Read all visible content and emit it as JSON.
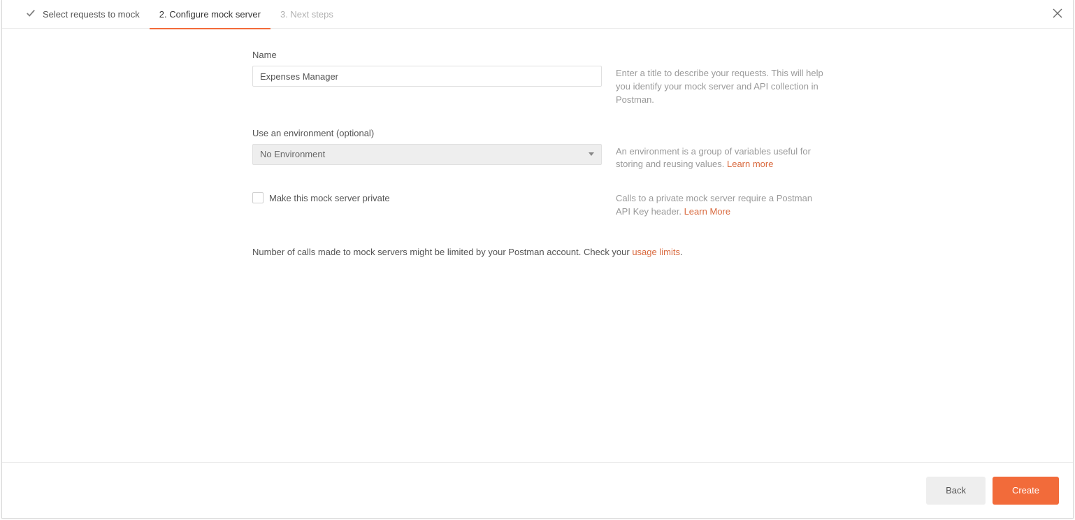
{
  "tabs": {
    "step1": "Select requests to mock",
    "step2": "2. Configure mock server",
    "step3": "3. Next steps"
  },
  "form": {
    "nameLabel": "Name",
    "nameValue": "Expenses Manager",
    "nameHelp": "Enter a title to describe your requests. This will help you identify your mock server and API collection in Postman.",
    "envLabel": "Use an environment (optional)",
    "envValue": "No Environment",
    "envHelp": "An environment is a group of variables useful for storing and reusing values. ",
    "envLearnMore": "Learn more",
    "privateLabel": "Make this mock server private",
    "privateHelp": "Calls to a private mock server require a Postman API Key header. ",
    "privateLearnMore": "Learn More",
    "limitsPrefix": "Number of calls made to mock servers might be limited by your Postman account. Check your ",
    "limitsLink": "usage limits",
    "limitsSuffix": "."
  },
  "footer": {
    "back": "Back",
    "create": "Create"
  }
}
